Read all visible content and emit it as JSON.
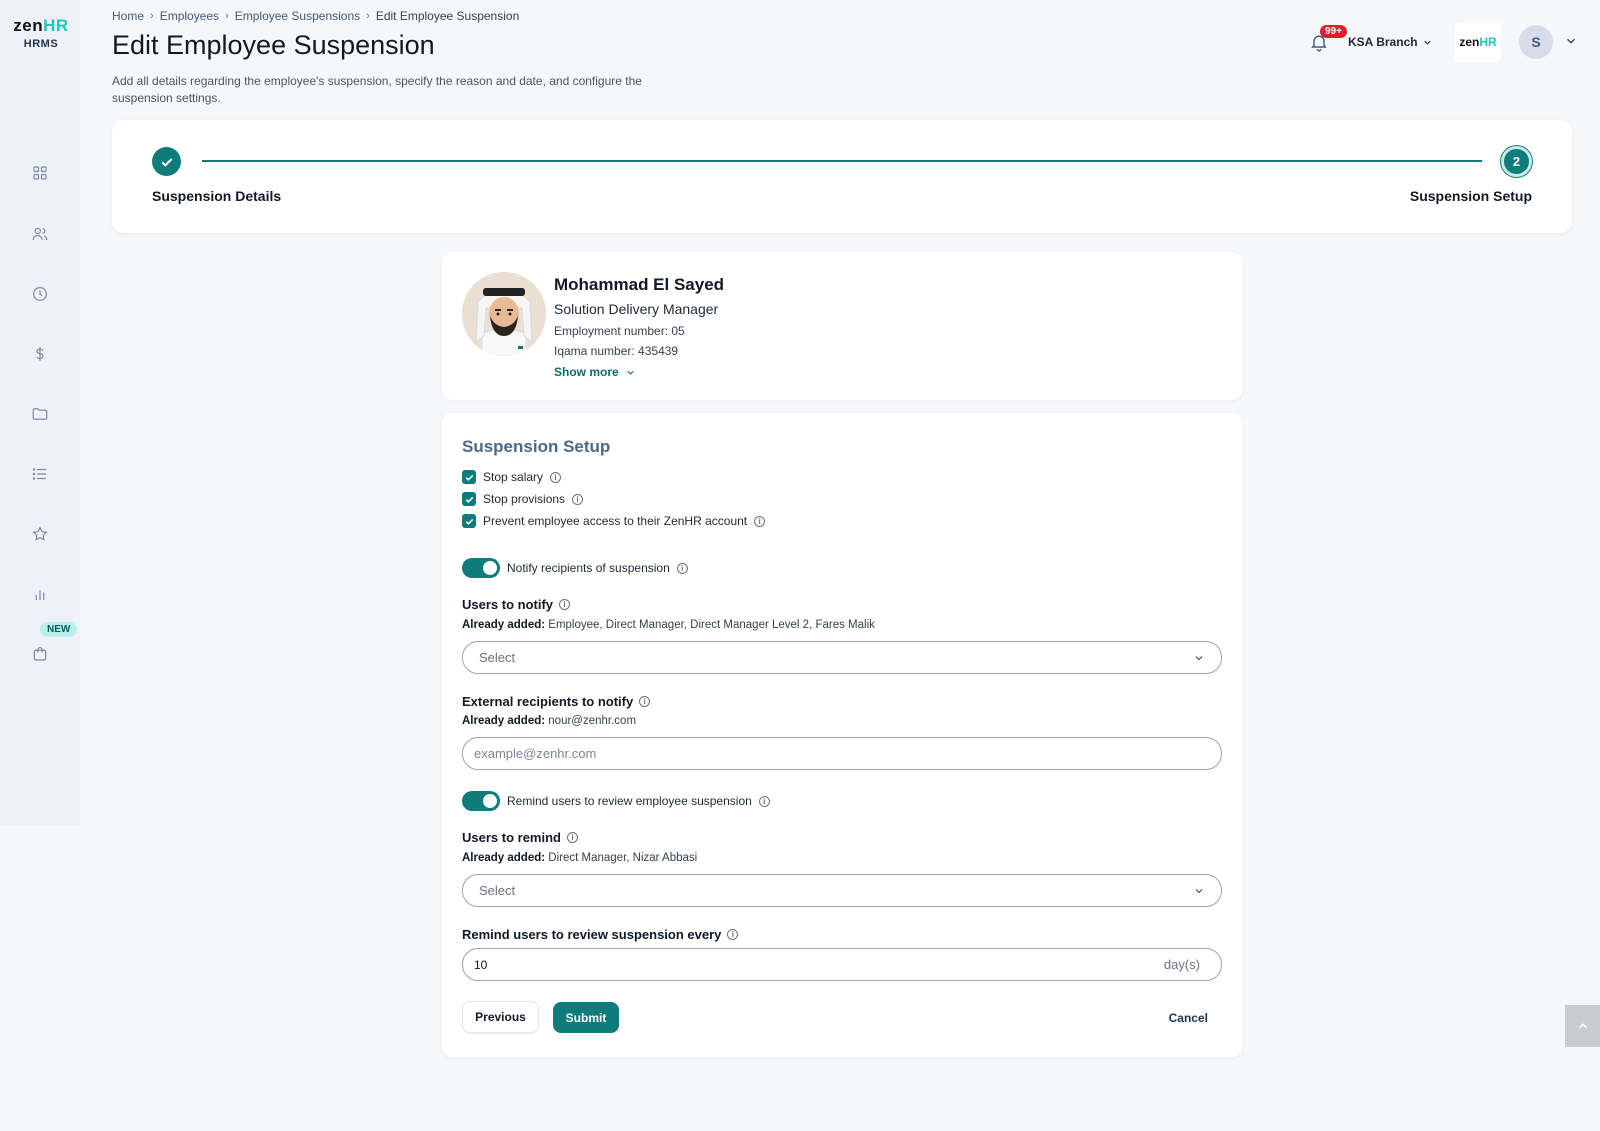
{
  "app": {
    "logo_main": "zen",
    "logo_accent": "HR",
    "logo_sub": "HRMS"
  },
  "sidebar": {
    "new_badge": "NEW"
  },
  "breadcrumb": [
    "Home",
    "Employees",
    "Employee Suspensions",
    "Edit Employee Suspension"
  ],
  "header": {
    "title": "Edit Employee Suspension",
    "description": "Add all details regarding the employee's suspension, specify the reason and date, and configure the suspension settings.",
    "notifications": "99+",
    "branch": "KSA Branch",
    "company_logo_main": "zen",
    "company_logo_accent": "HR",
    "avatar_initial": "S"
  },
  "stepper": {
    "step1": "Suspension Details",
    "step2_number": "2",
    "step2": "Suspension Setup"
  },
  "employee": {
    "name": "Mohammad El Sayed",
    "title": "Solution Delivery Manager",
    "employment_number": "Employment number: 05",
    "iqama_number": "Iqama number: 435439",
    "show_more": "Show more"
  },
  "setup": {
    "title": "Suspension Setup",
    "checkboxes": [
      {
        "label": "Stop salary",
        "checked": true
      },
      {
        "label": "Stop provisions",
        "checked": true
      },
      {
        "label": "Prevent employee access to their ZenHR account",
        "checked": true
      }
    ],
    "notify_toggle": "Notify recipients of suspension",
    "users_to_notify": {
      "label": "Users to notify",
      "already_label": "Already added:",
      "already_value": "Employee, Direct Manager, Direct Manager Level 2, Fares Malik",
      "placeholder": "Select"
    },
    "external_recipients": {
      "label": "External recipients to notify",
      "already_label": "Already added:",
      "already_value": "nour@zenhr.com",
      "placeholder": "example@zenhr.com"
    },
    "remind_toggle": "Remind users to review employee suspension",
    "users_to_remind": {
      "label": "Users to remind",
      "already_label": "Already added:",
      "already_value": "Direct Manager, Nizar Abbasi",
      "placeholder": "Select"
    },
    "remind_every": {
      "label": "Remind users to review suspension every",
      "value": "10",
      "suffix": "day(s)"
    },
    "buttons": {
      "previous": "Previous",
      "submit": "Submit",
      "cancel": "Cancel"
    }
  },
  "colors": {
    "accent": "#0e7c7b",
    "badge": "#e11d2e",
    "logo_accent": "#1ec6c0"
  }
}
